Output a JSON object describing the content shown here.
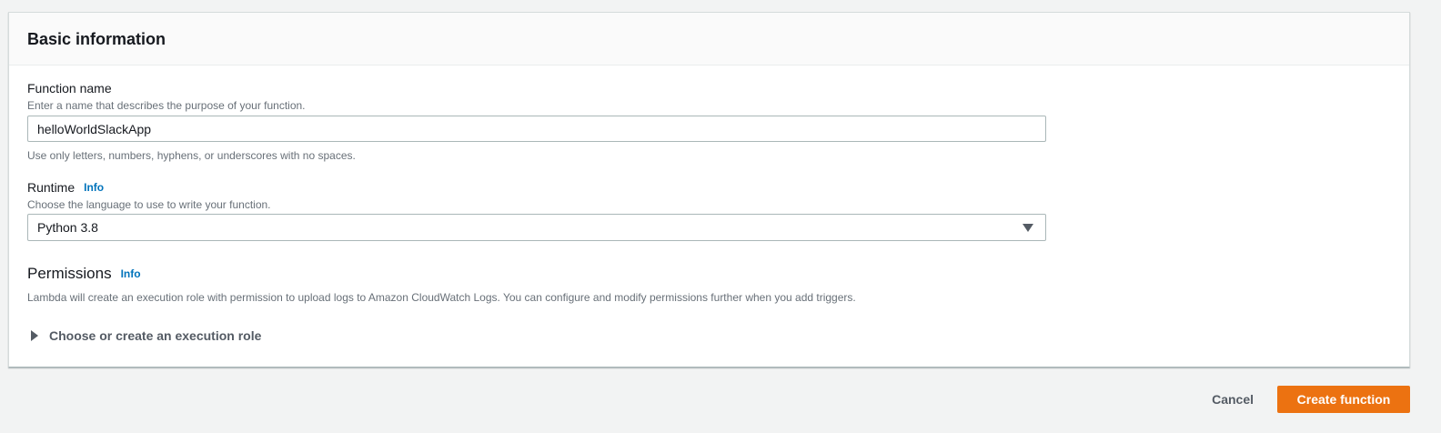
{
  "panel": {
    "title": "Basic information"
  },
  "function_name": {
    "label": "Function name",
    "description": "Enter a name that describes the purpose of your function.",
    "value": "helloWorldSlackApp",
    "constraint": "Use only letters, numbers, hyphens, or underscores with no spaces."
  },
  "runtime": {
    "label": "Runtime",
    "info": "Info",
    "description": "Choose the language to use to write your function.",
    "selected": "Python 3.8"
  },
  "permissions": {
    "title": "Permissions",
    "info": "Info",
    "description": "Lambda will create an execution role with permission to upload logs to Amazon CloudWatch Logs. You can configure and modify permissions further when you add triggers.",
    "expander_label": "Choose or create an execution role"
  },
  "actions": {
    "cancel": "Cancel",
    "create": "Create function"
  },
  "colors": {
    "primary": "#ec7211",
    "link": "#0073bb"
  }
}
